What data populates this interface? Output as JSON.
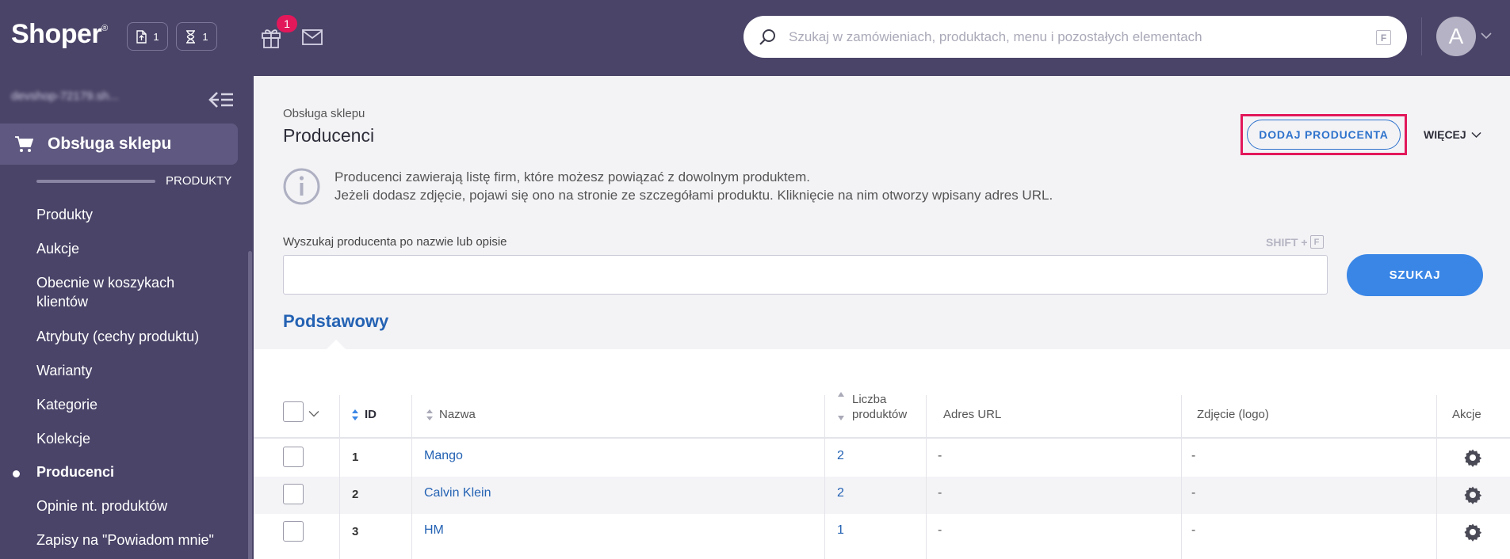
{
  "app": {
    "logo": "Shoper",
    "logo_mark": "®",
    "counters": [
      {
        "icon": "document-icon",
        "count": "1"
      },
      {
        "icon": "hourglass-icon",
        "count": "1"
      }
    ],
    "gift_badge": "1",
    "search_placeholder": "Szukaj w zamówieniach, produktach, menu i pozostałych elementach",
    "search_shortcut": "F",
    "avatar_letter": "A"
  },
  "sidebar": {
    "shop_name": "devshop-72179.sh...",
    "section": "Obsługa sklepu",
    "group": "PRODUKTY",
    "items": [
      {
        "label": "Produkty"
      },
      {
        "label": "Aukcje"
      },
      {
        "label": "Obecnie w koszykach klientów"
      },
      {
        "label": "Atrybuty (cechy produktu)"
      },
      {
        "label": "Warianty"
      },
      {
        "label": "Kategorie"
      },
      {
        "label": "Kolekcje"
      },
      {
        "label": "Producenci",
        "active": true
      },
      {
        "label": "Opinie nt. produktów"
      },
      {
        "label": "Zapisy na \"Powiadom mnie\""
      }
    ]
  },
  "page": {
    "breadcrumb": "Obsługa sklepu",
    "title": "Producenci",
    "add_button": "DODAJ PRODUCENTA",
    "more_button": "WIĘCEJ",
    "info_line1": "Producenci zawierają listę firm, które możesz powiązać z dowolnym produktem.",
    "info_line2": "Jeżeli dodasz zdjęcie, pojawi się ono na stronie ze szczegółami produktu. Kliknięcie na nim otworzy wpisany adres URL.",
    "search_label": "Wyszukaj producenta po nazwie lub opisie",
    "search_shortcut_prefix": "SHIFT +",
    "search_shortcut_key": "F",
    "search_value": "",
    "search_button": "SZUKAJ",
    "tab": "Podstawowy"
  },
  "table": {
    "headers": {
      "id": "ID",
      "name": "Nazwa",
      "count_line1": "Liczba",
      "count_line2": "produktów",
      "url": "Adres URL",
      "logo": "Zdjęcie (logo)",
      "actions": "Akcje"
    },
    "rows": [
      {
        "id": "1",
        "name": "Mango",
        "count": "2",
        "url": "-",
        "logo": "-"
      },
      {
        "id": "2",
        "name": "Calvin Klein",
        "count": "2",
        "url": "-",
        "logo": "-"
      },
      {
        "id": "3",
        "name": "HM",
        "count": "1",
        "url": "-",
        "logo": "-"
      }
    ]
  },
  "colors": {
    "topbar": "#4a4468",
    "accent": "#3a86e6",
    "link": "#2462b3",
    "highlight": "#e2185b"
  }
}
